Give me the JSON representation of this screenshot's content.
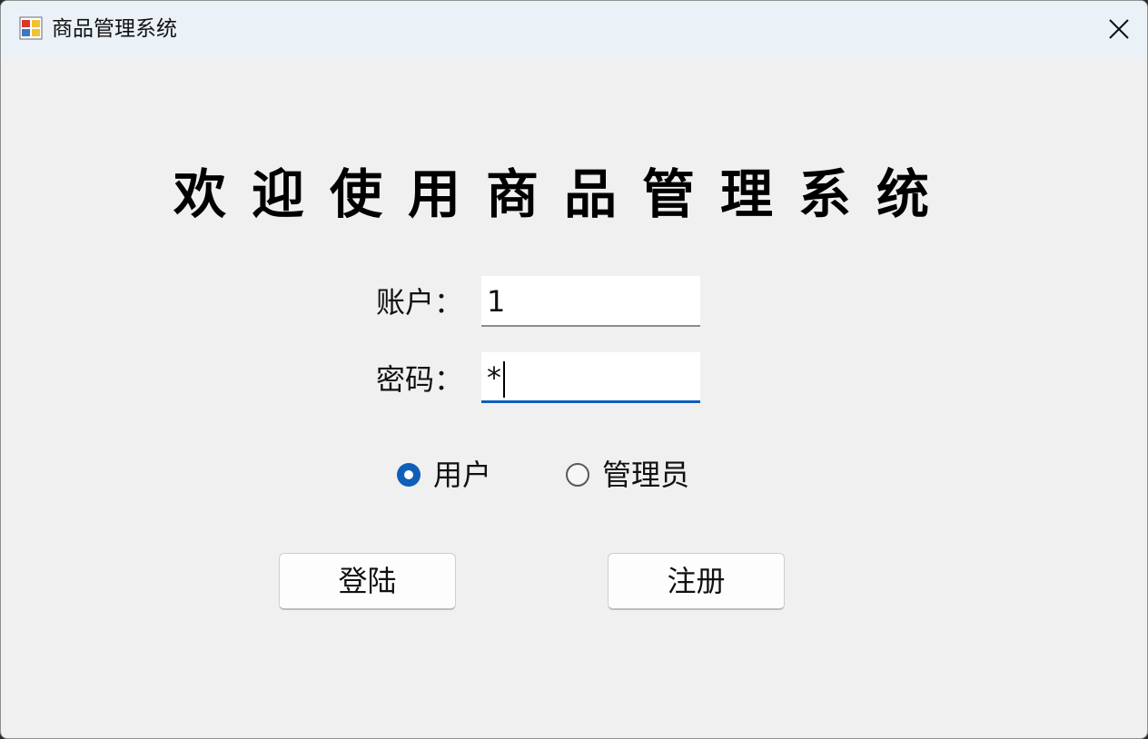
{
  "window": {
    "title": "商品管理系统",
    "icon": "app-window-icon",
    "close_icon": "close-icon"
  },
  "main": {
    "welcome_text": "欢迎使用商品管理系统",
    "account_label": "账户：",
    "account_value": "1",
    "password_label": "密码：",
    "password_value": "*",
    "role_user_label": "用户",
    "role_admin_label": "管理员",
    "selected_role": "用户",
    "login_button": "登陆",
    "register_button": "注册"
  },
  "colors": {
    "accent": "#0e5fb8",
    "titlebar": "#eaf2f7",
    "window_bg": "#f0f0f0"
  }
}
